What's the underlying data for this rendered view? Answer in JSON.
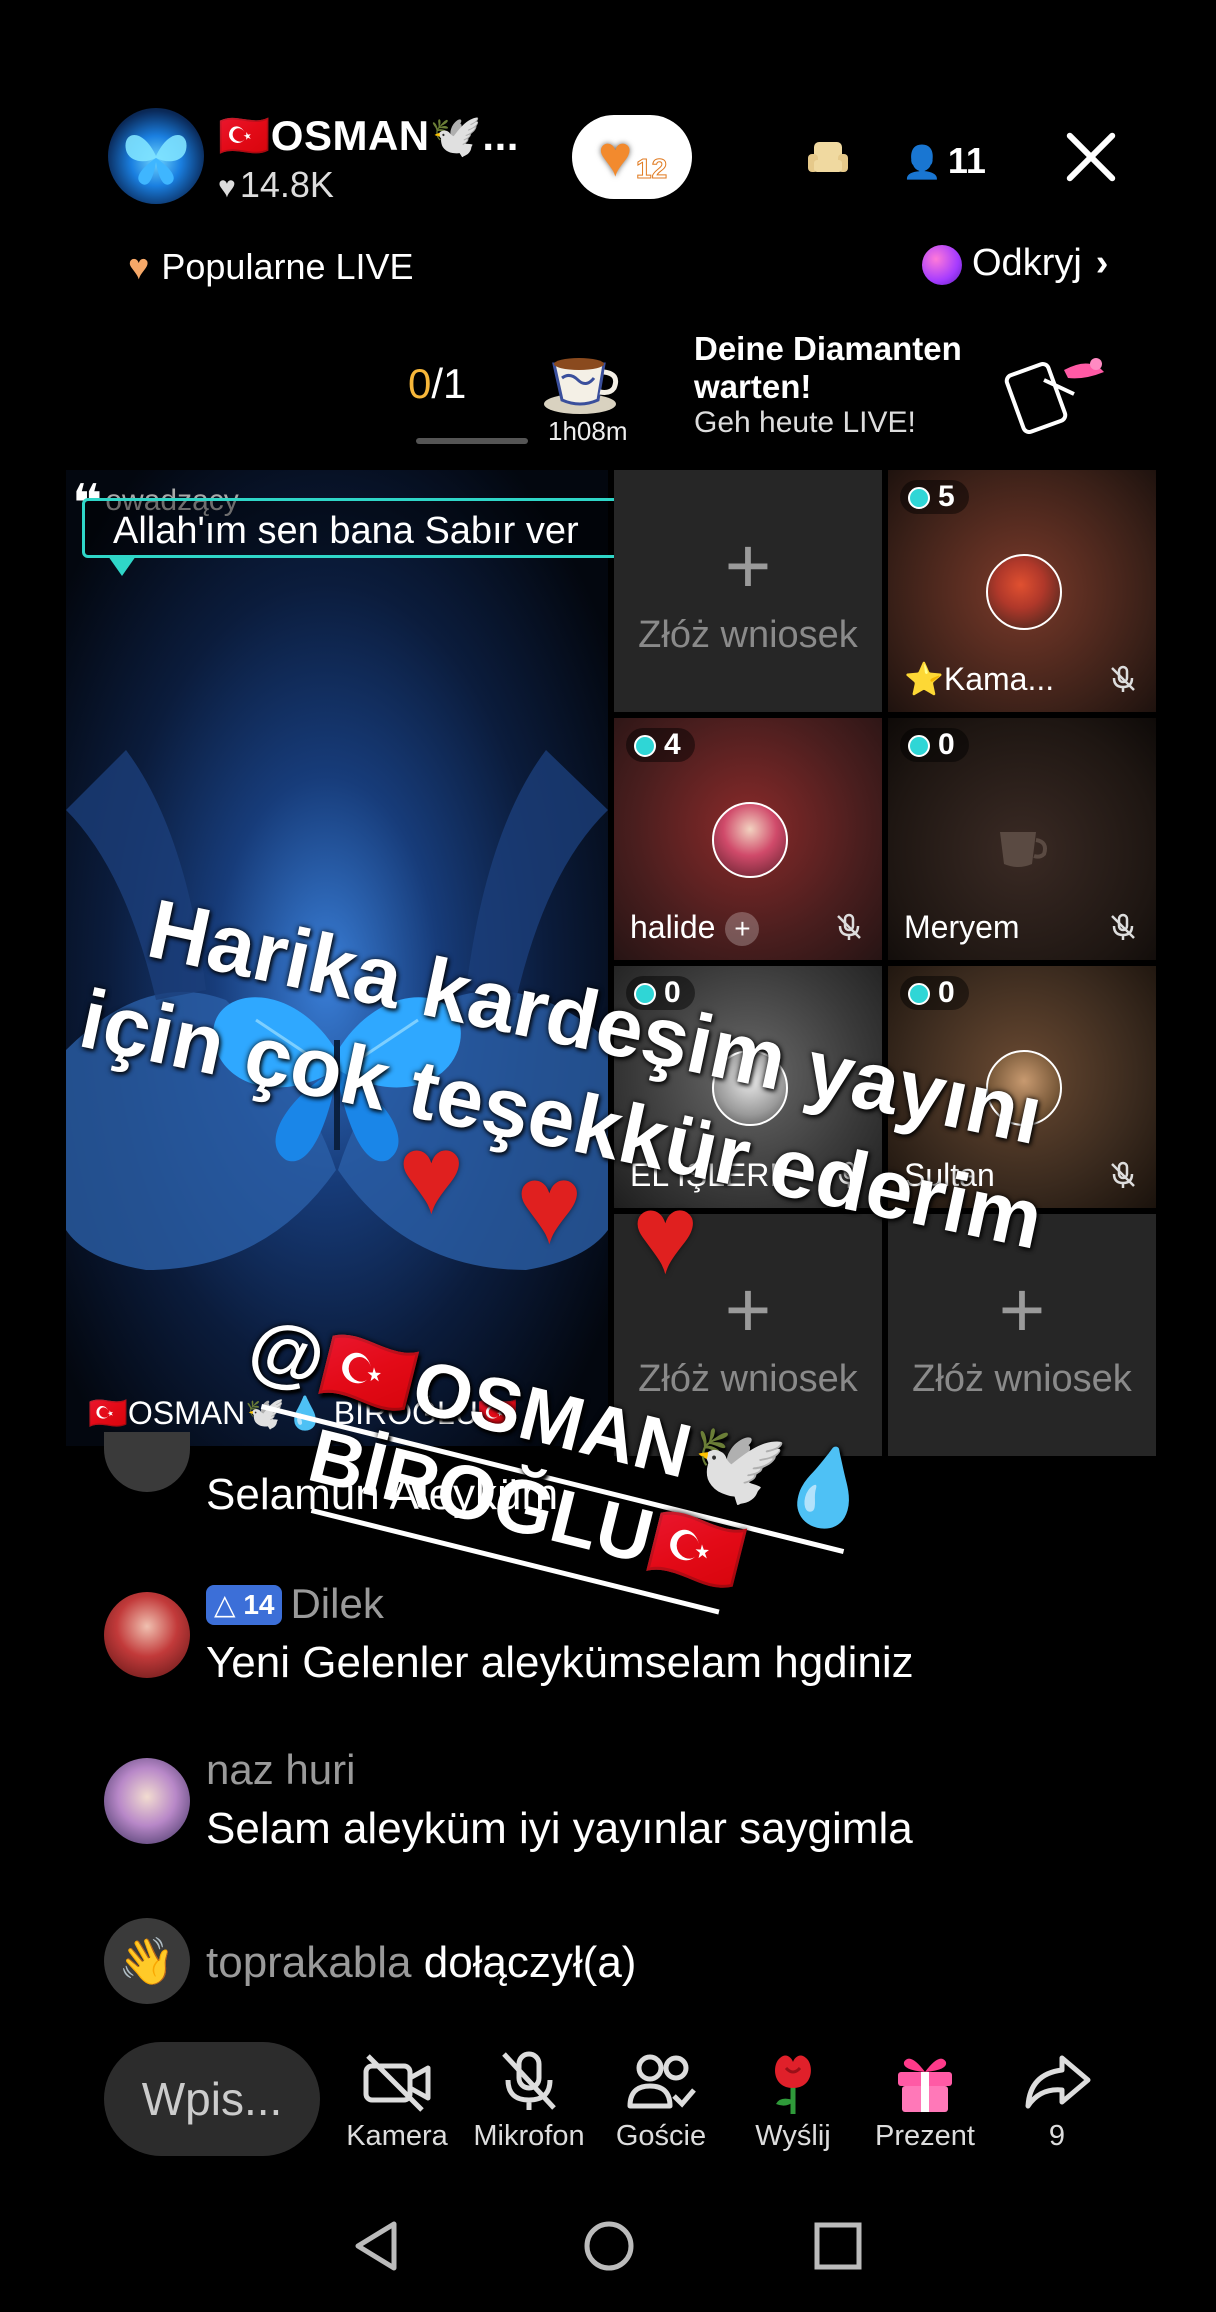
{
  "header": {
    "host_name": "🇹🇷OSMAN🕊️...",
    "host_likes": "14.8K",
    "follow_count": "12",
    "viewer_count": "11"
  },
  "subheader": {
    "popular_label": "Popularne LIVE",
    "discover_label": "Odkryj"
  },
  "mission": {
    "progress_current": "0",
    "progress_total": "/1",
    "timer": "1h08m",
    "title": "Deine Diamanten warten!",
    "subtitle": "Geh heute LIVE!"
  },
  "stage": {
    "host_tag_label": "owadzący",
    "pinned_message": "Allah'ım sen bana Sabır ver",
    "apply_label": "Złóż wniosek",
    "guests": [
      {
        "name": "⭐Kama...",
        "gems": "5"
      },
      {
        "name": "halide",
        "gems": "4"
      },
      {
        "name": "Meryem",
        "gems": "0"
      },
      {
        "name": "EL IŞLERI",
        "gems": "0"
      },
      {
        "name": "Sultan",
        "gems": "0"
      }
    ],
    "host_label": "🇹🇷OSMAN🕊️💧 BİROĞLU🇹🇷"
  },
  "overlay": {
    "line1": "Harika kardeşim yayını",
    "line2": "için çok teşekkür ederim",
    "mention_line1": "@🇹🇷OSMAN🕊️💧",
    "mention_line2": "BİROĞLU🇹🇷"
  },
  "chat": [
    {
      "name": "",
      "text": "Selamun Aleyküm"
    },
    {
      "name": "Dilek",
      "level": "14",
      "text": "Yeni Gelenler aleykümselam hgdiniz"
    },
    {
      "name": "naz huri",
      "text": "Selam aleyküm iyi yayınlar saygimla"
    },
    {
      "name": "toprakabla",
      "text": "dołączył(a)"
    }
  ],
  "bottom_bar": {
    "input_placeholder": "Wpis...",
    "camera_label": "Kamera",
    "mic_label": "Mikrofon",
    "guests_label": "Goście",
    "send_label": "Wyślij",
    "gift_label": "Prezent",
    "share_count": "9"
  },
  "icons": {
    "host_avatar": "butterfly-avatar",
    "sofa": "sofa-icon",
    "viewers": "person-icon",
    "close": "close-icon",
    "camera": "camera-off-icon",
    "mic": "mic-off-icon",
    "guests": "guests-icon",
    "rose": "rose-icon",
    "gift": "gift-icon",
    "share": "share-icon"
  },
  "colors": {
    "accent_gold": "#f7b73a",
    "pinned_border": "#2fd6c8",
    "heart_red": "#e0201f",
    "gift_pink": "#ff5aa5"
  }
}
